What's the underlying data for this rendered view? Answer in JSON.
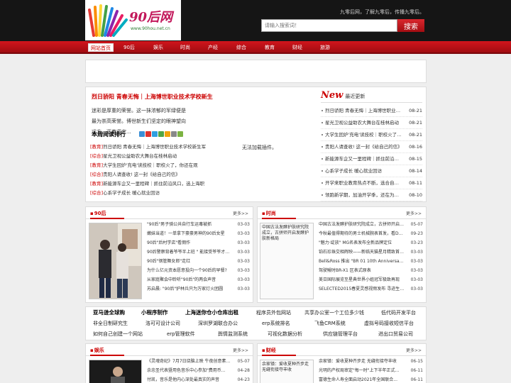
{
  "site": {
    "logo_text": "90后网",
    "logo_url_text": "www.90hou.net.cn",
    "slogan": "九零后网，了解九零后，传播九零后。"
  },
  "search": {
    "placeholder": "请输入搜索词！",
    "button_label": "搜索"
  },
  "nav": {
    "items": [
      "网站首页",
      "90后",
      "娱乐",
      "时尚",
      "产经",
      "综合",
      "教育",
      "财经",
      "旅游"
    ]
  },
  "top": {
    "headline": "烈日骄阳 青春无悔｜上海博世职业技术学校新生",
    "intro": "迷彩是厚重的荣誉。这一抹浓郁的军绿便是最为崇高荣誉。博世新生们坚定的眼神望向远方，迈着坚定...",
    "rank_title": "本周阅读排行",
    "rank_items": [
      {
        "cat": "[教育]",
        "title": "烈日骄阳 青春无悔｜上海博世职业技术学校新生军"
      },
      {
        "cat": "[综合]",
        "title": "星光卫视公益助农大舞台在桂林启动"
      },
      {
        "cat": "[教育]",
        "title": "大学生回炉'充电'读技校｜职校火了，你还在观"
      },
      {
        "cat": "[综合]",
        "title": "贵阳人请查收! 这一封《给自己的信》"
      },
      {
        "cat": "[教育]",
        "title": "新能源车企又一里程碑｜抓住前沿风口，选上海职"
      },
      {
        "cat": "[综合]",
        "title": "心系学子成长 暖心就业回访"
      }
    ],
    "no_plugin": "无法加载插件。",
    "new_big": "New",
    "new_small": "最近更新",
    "new_items": [
      {
        "title": "烈日骄阳 青春无悔｜上海博世职业技术",
        "date": "08-21"
      },
      {
        "title": "星光卫视公益助农大舞台在桂林启动",
        "date": "08-21"
      },
      {
        "title": "大学生回炉'充电'读技校｜职校火了，...",
        "date": "08-21"
      },
      {
        "title": "贵阳人请查收! 这一封《给自己的信》",
        "date": "08-16"
      },
      {
        "title": "新能源车企又一里程碑｜抓住前沿风口",
        "date": "08-15"
      },
      {
        "title": "心系学子成长 暖心就业回访",
        "date": "08-14"
      },
      {
        "title": "开学来职业教育热点不断，选合自己的...",
        "date": "08-11"
      },
      {
        "title": "领跑新学期，加油开学季，还在为报考...",
        "date": "08-10"
      }
    ]
  },
  "panel_90": {
    "title": "90后",
    "more": "更多>>",
    "items": [
      {
        "title": "\"90后\"男子骑公共自行车运毒被抓",
        "date": "03-03"
      },
      {
        "title": "嫩妹当道！一单拿下豪豪男神的90后女星",
        "date": "03-03"
      },
      {
        "title": "90后\"后村学店\"看佣作",
        "date": "03-03"
      },
      {
        "title": "90后警察背着爷爷半上班 \" 能接受爷爷才能当...",
        "date": "03-03"
      },
      {
        "title": "90后\"钢管舞女郎\"走红",
        "date": "03-03"
      },
      {
        "title": "为什么亿元资本愿意投向一个90后的早餐?",
        "date": "03-03"
      },
      {
        "title": "从家庭聚会中聆听\"90后\"的两会声音",
        "date": "03-03"
      },
      {
        "title": "苏启晨: \"90后\"护林兵只为万家灯火团圆",
        "date": "03-03"
      }
    ]
  },
  "panel_fashion": {
    "title": "时尚",
    "more": "更多>>",
    "photo_caption": "中国古法发酵护肤研究院成立，古拼师开启发酵护肤新格局",
    "items": [
      {
        "title": "中国古法发酵护肤研究院成立，古拼师开启发...",
        "date": "05-07"
      },
      {
        "title": "今秋最值得期待的男士机械腕表首发，看Da...",
        "date": "09-23"
      },
      {
        "title": "\"魅力·绽放\" MG名表发布全新品牌定位",
        "date": "03-23"
      },
      {
        "title": "铂石珍珠交相辉映——新临天猫星月精致首饰...",
        "date": "03-03"
      },
      {
        "title": "Bell&Ross 推出 \"BR 01 10th Anniversary\"限...",
        "date": "03-03"
      },
      {
        "title": "驾驶鳗时BR-X1 区表式原表",
        "date": "03-03"
      },
      {
        "title": "美日国际展览至星典世界小姐冠军极致再现",
        "date": "03-03"
      },
      {
        "title": "SELECTED2015春夏灵感视频发布 寻迹生命...",
        "date": "03-03"
      }
    ]
  },
  "links": {
    "rows": [
      [
        "亚马逊全球购",
        "小程序制作",
        "上海迷你仓小仓库出租",
        "程序员外包网站",
        "共享办公室一个工位多少钱",
        "低代码开发平台"
      ],
      [
        "非全日制研究生",
        "洛可可设计公司",
        "深圳罗湖联合办公",
        "erp系统排名",
        "飞鱼CRM系统",
        "虚拟号码接收短信平台"
      ],
      [
        "如何自己创建一个网站",
        "erp管理软件",
        "舆情监测系统",
        "可视化数据分析",
        "供应链管理平台",
        "进出口贸易公司"
      ]
    ],
    "top_button": "▲"
  },
  "panel_ent": {
    "title": "娱乐",
    "more": "更多>>",
    "items": [
      {
        "title": "《灵魂奇纪》7月7日烧脑上映 牛夜创意素命...",
        "date": "05-07"
      },
      {
        "title": "余忠圣代表暨用色音乐中心参加\"费用币...",
        "date": "04-28"
      },
      {
        "title": "付凯，音乐是他内心深处最真实的声音",
        "date": "04-23"
      }
    ]
  },
  "panel_fin": {
    "title": "财经",
    "more": "更多>>",
    "photo_caption": "余家镇：爱收夏种齐步走 无缝衔接夺丰收",
    "items": [
      {
        "title": "余家镇：爱收夏种齐步走 无缝衔接夺丰收",
        "date": "06-15"
      },
      {
        "title": "光明的产权局审定\"每一时\"上下半年正式...",
        "date": "06-11"
      },
      {
        "title": "富德生命人寿全面启动2021年全国联合...",
        "date": "06-11"
      }
    ]
  },
  "colors": {
    "brand_red": "#c00000",
    "header_bg": "#151515"
  }
}
